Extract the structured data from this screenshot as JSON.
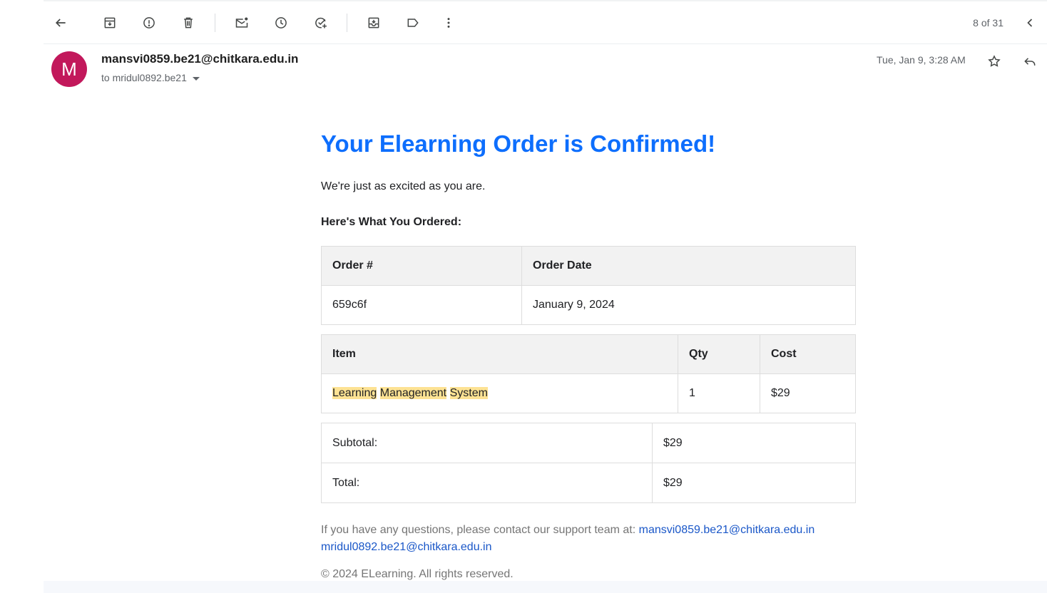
{
  "toolbar": {
    "pager": "8 of 31",
    "icons": [
      "back-icon",
      "archive-icon",
      "report-spam-icon",
      "delete-icon",
      "mark-unread-icon",
      "snooze-icon",
      "add-task-icon",
      "move-to-icon",
      "label-icon",
      "more-icon",
      "prev-icon"
    ]
  },
  "header": {
    "avatar_letter": "M",
    "avatar_color": "#c2185b",
    "sender": "mansvi0859.be21@chitkara.edu.in",
    "to": "to mridul0892.be21",
    "date": "Tue, Jan 9, 3:28 AM"
  },
  "email": {
    "title": "Your Elearning Order is Confirmed!",
    "title_color": "#0d6efd",
    "intro": "We're just as excited as you are.",
    "subhead": "Here's What You Ordered:",
    "order_table": {
      "headers": [
        "Order #",
        "Order Date"
      ],
      "row": [
        "659c6f",
        "January 9, 2024"
      ]
    },
    "items_table": {
      "headers": [
        "Item",
        "Qty",
        "Cost"
      ],
      "item_words": [
        "Learning",
        "Management",
        "System"
      ],
      "qty": "1",
      "cost": "$29"
    },
    "totals": [
      {
        "label": "Subtotal:",
        "value": "$29"
      },
      {
        "label": "Total:",
        "value": "$29"
      }
    ],
    "contact_text": "If you have any questions, please contact our support team at: ",
    "contact_email_1": "mansvi0859.be21@chitkara.edu.in",
    "contact_email_2": "mridul0892.be21@chitkara.edu.in",
    "copyright": "© 2024 ELearning. All rights reserved."
  }
}
